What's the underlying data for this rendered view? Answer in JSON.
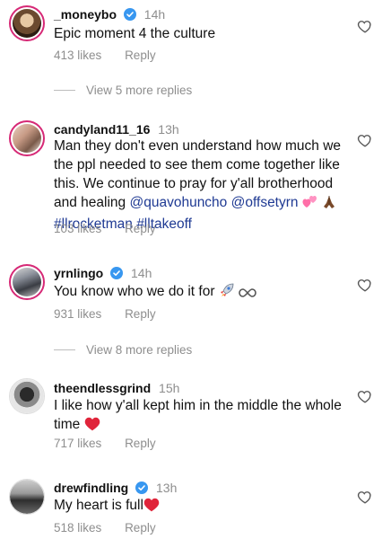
{
  "comments": [
    {
      "username": "_moneybo",
      "time": "14h",
      "verified": true,
      "text": "Epic moment 4 the culture",
      "likes": "413 likes",
      "reply": "Reply"
    },
    {
      "username": "candyland11_16",
      "time": "13h",
      "verified": false,
      "text": "Man they don't even understand how much we the ppl needed to see them come together like this. We continue to pray for y'all brotherhood and healing",
      "mention1": "@quavohuncho",
      "mention2": "@offsetyrn",
      "hashtag1": "#llrocketman",
      "hashtag2": "#lltakeoff",
      "likes": "103 likes",
      "reply": "Reply"
    },
    {
      "username": "yrnlingo",
      "time": "14h",
      "verified": true,
      "text": "You know who we do it for",
      "likes": "931 likes",
      "reply": "Reply"
    },
    {
      "username": "theendlessgrind",
      "time": "15h",
      "verified": false,
      "text": "I like how y'all kept him in the middle the whole time",
      "likes": "717 likes",
      "reply": "Reply"
    },
    {
      "username": "drewfindling",
      "time": "13h",
      "verified": true,
      "text": "My heart is full",
      "likes": "518 likes",
      "reply": "Reply"
    }
  ],
  "view_more": [
    "View 5 more replies",
    "View 8 more replies"
  ],
  "icons": {
    "heart": "heart-outline-icon",
    "verified": "verified-badge-icon",
    "emoji_heart": "red-heart-emoji",
    "emoji_rocket": "rocket-emoji",
    "emoji_infinity": "infinity-emoji",
    "emoji_pink_hearts": "two-hearts-emoji",
    "emoji_pray": "folded-hands-emoji"
  },
  "colors": {
    "accent_link": "#1f3a93",
    "muted": "#8e8e8e",
    "story_ring": "#d62976",
    "verified": "#3897f0"
  }
}
